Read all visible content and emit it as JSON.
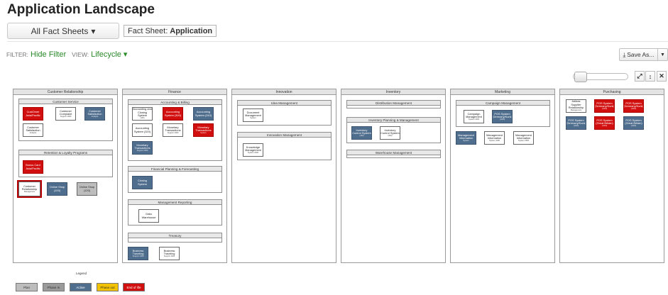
{
  "page_title": "Application Landscape",
  "fact_sheet_menu": "All Fact Sheets",
  "fact_sheet_filter": {
    "label": "Fact Sheet:",
    "value": "Application"
  },
  "filter_label": "FILTER:",
  "hide_filter": "Hide Filter",
  "view_label": "VIEW:",
  "view_value": "Lifecycle",
  "save_as": "Save As...",
  "lanes": {
    "customer_relationship": "Customer Relationship",
    "finance": "Finance",
    "innovation": "Innovation",
    "inventory": "Inventory",
    "marketing": "Marketing",
    "purchasing": "Purchasing"
  },
  "groups": {
    "customer_service": "Customer Service",
    "retention": "Retention & Loyalty Programs",
    "accounting_billing": "Accounting & Billing",
    "financial_planning": "Financial Planning & Forecasting",
    "management_reporting": "Management Reporting",
    "treasury": "Treasury",
    "idea_management": "Idea Management",
    "innovation_management": "Innovation Management",
    "distribution_management": "Distribution Management",
    "inventory_planning": "Inventory Planning & Management",
    "warehouse_management": "Warehouse Management",
    "campaign_management": "Campaign Management"
  },
  "apps": {
    "a1": {
      "l1": "CustOmer",
      "l2": "Asia/Pacific",
      "sub": ""
    },
    "a2": {
      "l1": "Customer",
      "l2": "Complaint",
      "sub": "Support 1000"
    },
    "a3": {
      "l1": "Customer",
      "l2": "Satisfaction",
      "sub": "Analysis"
    },
    "a4": {
      "l1": "Customer",
      "l2": "Satisfaction",
      "sub": "Analysis"
    },
    "a5": {
      "l1": "Bonus Card",
      "l2": "Asia/Pacific",
      "sub": ""
    },
    "a6": {
      "l1": "Customer",
      "l2": "Relationship",
      "sub": "Management"
    },
    "a7": {
      "l1": "Online Shop",
      "l2": "(100)",
      "sub": ""
    },
    "a8": {
      "l1": "Online Shop",
      "l2": "(120)",
      "sub": ""
    },
    "b1": {
      "l1": "Accounting and",
      "l2": "Closing System",
      "sub": "(100)"
    },
    "b2": {
      "l1": "Accounting",
      "l2": "System (300)",
      "sub": ""
    },
    "b3": {
      "l1": "Accounting",
      "l2": "System (310)",
      "sub": ""
    },
    "b4": {
      "l1": "Accounting",
      "l2": "System (320)",
      "sub": ""
    },
    "b5": {
      "l1": "Monetary",
      "l2": "Transactions",
      "sub": "Support 1000"
    },
    "b6": {
      "l1": "Monetary",
      "l2": "Transactions",
      "sub": "System"
    },
    "b7": {
      "l1": "Monetary",
      "l2": "Transactions",
      "sub": "Support 2000"
    },
    "b8": {
      "l1": "Closing System",
      "l2": "",
      "sub": ""
    },
    "b9": {
      "l1": "Data",
      "l2": "Warehouse",
      "sub": ""
    },
    "b10": {
      "l1": "Business",
      "l2": "Traveling",
      "sub": "Support 1000"
    },
    "b11": {
      "l1": "Business",
      "l2": "Traveling",
      "sub": "Support 1100"
    },
    "c1": {
      "l1": "Document",
      "l2": "Management",
      "sub": "System"
    },
    "c2": {
      "l1": "Knowledge",
      "l2": "Management",
      "sub": "System 2400"
    },
    "d1": {
      "l1": "Inventory",
      "l2": "Control System",
      "sub": "(100)"
    },
    "d2": {
      "l1": "Inventory",
      "l2": "Control System",
      "sub": "(200)"
    },
    "e1": {
      "l1": "Campaign",
      "l2": "Management",
      "sub": "System 1000"
    },
    "e2": {
      "l1": "POS System",
      "l2": "(Germany/Kunk)",
      "sub": "(1000)"
    },
    "e3": {
      "l1": "Management",
      "l2": "Information",
      "sub": "System"
    },
    "e4": {
      "l1": "Management",
      "l2": "Information",
      "sub": "System 1100"
    },
    "e5": {
      "l1": "Management",
      "l2": "Information",
      "sub": "System 1500"
    },
    "f1": {
      "l1": "Adidas Supplier",
      "l2": "Relationship",
      "sub": "Management"
    },
    "f2": {
      "l1": "POS System",
      "l2": "(Germany/Kunk)",
      "sub": "(1000)"
    },
    "f3": {
      "l1": "POS System",
      "l2": "(Germany/Kunk)",
      "sub": "(1000)"
    },
    "f4": {
      "l1": "POS System",
      "l2": "(Germany/Kunk)",
      "sub": "(1000)"
    },
    "f5": {
      "l1": "POS System",
      "l2": "(Great Britain)",
      "sub": "(1000)"
    },
    "f6": {
      "l1": "POS System",
      "l2": "(Great Britain)",
      "sub": "(1000)"
    }
  },
  "legend": {
    "title": "Legend",
    "items": [
      {
        "label": "Plan",
        "color": "#bdbdbd"
      },
      {
        "label": "Phase In",
        "color": "#9a9a9a"
      },
      {
        "label": "Active",
        "color": "#4f6d8d"
      },
      {
        "label": "Phase out",
        "color": "#f2c200"
      },
      {
        "label": "End of life",
        "color": "#d20f0f"
      }
    ]
  },
  "colors": {
    "active": "#4f6d8d",
    "end_of_life": "#d20f0f",
    "accent_link": "#2a8a2a"
  }
}
